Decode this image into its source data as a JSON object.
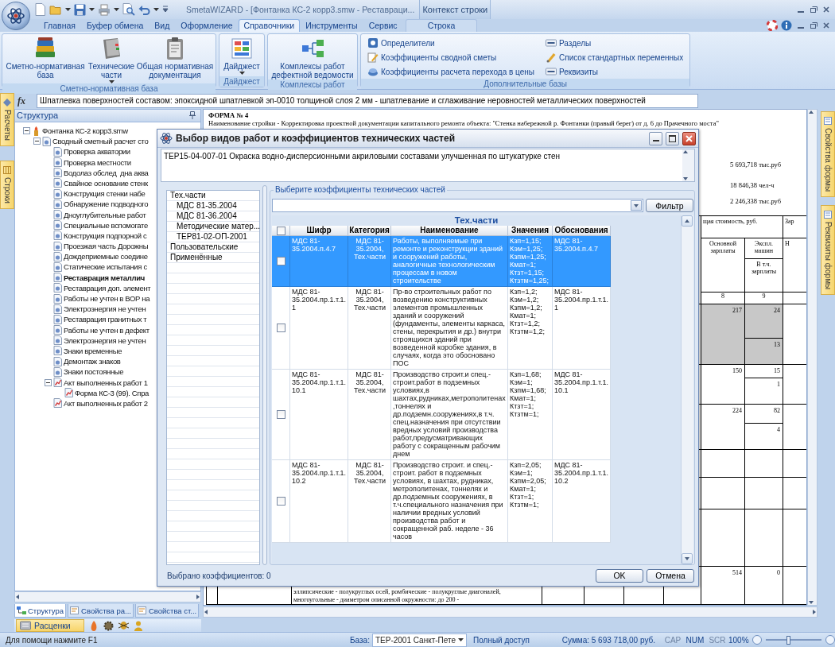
{
  "app": {
    "title": "SmetaWIZARD - [Фонтанка КС-2 корр3.smw - Реставраци...",
    "context_group": "Контекст строки"
  },
  "ribbon_tabs": [
    {
      "label": "Главная",
      "kind": "normal",
      "selected": false
    },
    {
      "label": "Буфер обмена",
      "kind": "normal",
      "selected": false
    },
    {
      "label": "Вид",
      "kind": "normal",
      "selected": false
    },
    {
      "label": "Оформление",
      "kind": "normal",
      "selected": false
    },
    {
      "label": "Справочники",
      "kind": "normal",
      "selected": true
    },
    {
      "label": "Инструменты",
      "kind": "normal",
      "selected": false
    },
    {
      "label": "Сервис",
      "kind": "normal",
      "selected": false
    },
    {
      "label": "Строка",
      "kind": "context",
      "selected": false
    }
  ],
  "ribbon_groups": [
    {
      "title": "Сметно-нормативная база",
      "items": [
        {
          "kind": "large",
          "label": "Сметно-нормативная база",
          "dropdown": false
        },
        {
          "kind": "large",
          "label": "Технические части",
          "dropdown": true
        },
        {
          "kind": "large",
          "label": "Общая нормативная документация",
          "dropdown": false
        }
      ]
    },
    {
      "title": "Дайджест",
      "items": [
        {
          "kind": "large",
          "label": "Дайджест",
          "dropdown": true
        }
      ]
    },
    {
      "title": "Комплексы работ",
      "items": [
        {
          "kind": "large",
          "label": "Комплексы работ дефектной ведомости",
          "dropdown": false
        }
      ]
    },
    {
      "title": "Дополнительные базы",
      "items": [
        {
          "kind": "small",
          "label": "Определители"
        },
        {
          "kind": "small",
          "label": "Коэффициенты сводной сметы"
        },
        {
          "kind": "small",
          "label": "Коэффициенты расчета перехода в цены"
        },
        {
          "kind": "small",
          "label": "Разделы"
        },
        {
          "kind": "small",
          "label": "Список стандартных переменных"
        },
        {
          "kind": "small",
          "label": "Реквизиты"
        }
      ]
    }
  ],
  "formula_bar": {
    "icon": "fx",
    "text": "Шпатлевка поверхностей составом: эпоксидной шпатлевкой эп-0010 толщиной слоя 2 мм - шпатлевание и сглаживание неровностей металлических поверхностей"
  },
  "left_tabs": [
    {
      "label": "Расчеты"
    },
    {
      "label": "Строки"
    }
  ],
  "right_tabs": [
    {
      "label": "Свойства формы"
    },
    {
      "label": "Реквизиты формы"
    }
  ],
  "structure_panel": {
    "title": "Структура",
    "tree": [
      {
        "label": "Фонтанка КС-2 корр3.smw",
        "kind": "file",
        "expanded": true,
        "active": false,
        "children": [
          {
            "label": "Сводный сметный расчет сто",
            "kind": "estimate",
            "expanded": true,
            "active": false,
            "children": [
              {
                "label": "Проверка акватории",
                "kind": "item",
                "active": false
              },
              {
                "label": "Проверка местности",
                "kind": "item",
                "active": false
              },
              {
                "label": "Водолаз обслед  дна аква",
                "kind": "item",
                "active": false
              },
              {
                "label": "Свайное основание стенк",
                "kind": "item",
                "active": false
              },
              {
                "label": "Конструкция стенки набе",
                "kind": "item",
                "active": false
              },
              {
                "label": "Обнаружение подводного",
                "kind": "item",
                "active": false
              },
              {
                "label": "Дноуглубительные работ",
                "kind": "item",
                "active": false
              },
              {
                "label": "Специальные вспомогате",
                "kind": "item",
                "active": false
              },
              {
                "label": "Конструкция подпорной с",
                "kind": "item",
                "active": false
              },
              {
                "label": "Проезжая часть Дорожны",
                "kind": "item",
                "active": false
              },
              {
                "label": "Дождеприемные соедине",
                "kind": "item",
                "active": false
              },
              {
                "label": "Статические испытания с",
                "kind": "item",
                "active": false
              },
              {
                "label": "Реставрация металлич",
                "kind": "item",
                "active": true
              },
              {
                "label": "Реставрация доп. элемент",
                "kind": "item",
                "active": false
              },
              {
                "label": "Работы не учтен в ВОР на",
                "kind": "item",
                "active": false
              },
              {
                "label": "Электроэнергия не учтен",
                "kind": "item",
                "active": false
              },
              {
                "label": "Реставрация гранитных т",
                "kind": "item",
                "active": false
              },
              {
                "label": "Работы не учтен в дефект",
                "kind": "item",
                "active": false
              },
              {
                "label": "Электроэнергия не учтен",
                "kind": "item",
                "active": false
              },
              {
                "label": "Знаки временные",
                "kind": "item",
                "active": false
              },
              {
                "label": "Демонтаж знаков",
                "kind": "item",
                "active": false
              },
              {
                "label": "Знаки постоянные",
                "kind": "item",
                "active": false
              },
              {
                "label": "Акт выполненных работ 1",
                "kind": "act",
                "expanded": true,
                "active": false,
                "children": [
                  {
                    "label": "Форма КС-3 (99). Спра",
                    "kind": "act",
                    "active": false
                  }
                ]
              },
              {
                "label": "Акт выполненных работ 2",
                "kind": "act",
                "active": false
              }
            ]
          }
        ]
      }
    ]
  },
  "panel_tabs": [
    {
      "label": "Структура",
      "selected": true
    },
    {
      "label": "Свойства ра...",
      "selected": false
    },
    {
      "label": "Свойства ст...",
      "selected": false
    }
  ],
  "rates_bar": {
    "label": "Расценки"
  },
  "document": {
    "form_title": "ФОРМА № 4",
    "heading": "Наименование стройки - Корректировка проектной документации капитального ремонта объекта: \"Стенка набережной р. Фонтанки (правый берег) от д. 6 до Прачечного моста\"",
    "totals": [
      "5 693,718 тыс.руб",
      "18 846,38 чел-ч",
      "2 246,338 тыс.руб"
    ],
    "table": {
      "cost_header": "щая стоимость, руб.",
      "cut_header": "Зар",
      "basic_wages": "Основной зарплаты",
      "machines": "Экспл. машин",
      "machine_wages": "В т.ч. зарплаты",
      "cut_subheader": "Н",
      "column_numbers": [
        "8",
        "9"
      ],
      "rows": [
        {
          "shaded": true,
          "basic_wages": "217",
          "machines": "24",
          "machine_wages": "13"
        },
        {
          "shaded": false,
          "basic_wages": "150",
          "machines": "15",
          "machine_wages": "1"
        },
        {
          "shaded": false,
          "basic_wages": "224",
          "machines": "82",
          "machine_wages": "4"
        },
        {
          "shaded": false
        },
        {
          "shaded": false
        },
        {
          "shaded": false
        },
        {
          "shaded": false,
          "text": "эллипсические - полукруглых осей, ромбические - полукруглые диагоналей, многоугольные - диаметром описанной окружности: до 200 -",
          "basic_wages": "514",
          "machines": "0"
        }
      ]
    }
  },
  "dialog": {
    "title": "Выбор видов работ и коэффициентов технических частей",
    "description": "ТЕР15-04-007-01 Окраска водно-дисперсионными акриловыми составами улучшенная по штукатурке стен",
    "categories": [
      {
        "label": "Тех.части",
        "children": [
          {
            "label": "МДС 81-35.2004"
          },
          {
            "label": "МДС 81-36.2004"
          },
          {
            "label": "Методические матер..."
          },
          {
            "label": "ТЕР81-02-ОП-2001"
          }
        ]
      },
      {
        "label": "Пользовательские"
      },
      {
        "label": "Применённые"
      }
    ],
    "group_title": "Выберите коэффициенты технических частей",
    "filter_button": "Фильтр",
    "table": {
      "title": "Тех.части",
      "all_checked": false,
      "columns": [
        "Шифр",
        "Категория",
        "Наименование",
        "Значения",
        "Обоснования"
      ],
      "rows": [
        {
          "selected": true,
          "checked": false,
          "cells": [
            "МДС 81-35.2004.п.4.7",
            "МДС 81-35.2004, Тех.части",
            "Работы, выполняемые при ремонте и реконструкции зданий и сооружений работы, аналогичные технологическим процессам в новом строительстве",
            "Кзп=1,15; Кэм=1,25; Кзпм=1,25; Кмат=1; Ктзт=1,15; Ктзтм=1,25;",
            "МДС 81-35.2004.п.4.7"
          ]
        },
        {
          "selected": false,
          "checked": false,
          "cells": [
            "МДС 81-35.2004.пр.1.т.1.1",
            "МДС 81-35.2004, Тех.части",
            "Пр-во строительных работ по возведению конструктивных элементов промышленных зданий и сооружений (фундаменты, элементы каркаса, стены, перекрытия и др.) внутри строящихся зданий при возведенной коробке здания, в случаях, когда это обосновано ПОС",
            "Кзп=1,2; Кэм=1,2; Кзпм=1,2; Кмат=1; Ктзт=1,2; Ктзтм=1,2;",
            "МДС 81-35.2004.пр.1.т.1.1"
          ]
        },
        {
          "selected": false,
          "checked": false,
          "cells": [
            "МДС 81-35.2004.пр.1.т.1.10.1",
            "МДС 81-35.2004, Тех.части",
            "Производство строит.и спец.-строит.работ в подземных условиях,в шахтах,рудниках,метрополитенах,тоннелях и др.подземн.сооружениях,в т.ч. спец.назначения при отсутствии вредных условий производства работ,предусматривающих работу с сокращенным рабочим днем",
            "Кзп=1,68; Кэм=1; Кзпм=1,68; Кмат=1; Ктзт=1; Ктзтм=1;",
            "МДС 81-35.2004.пр.1.т.1.10.1"
          ]
        },
        {
          "selected": false,
          "checked": false,
          "cells": [
            "МДС 81-35.2004.пр.1.т.1.10.2",
            "МДС 81-35.2004, Тех.части",
            "Производство строит. и спец.-строит. работ в подземных условиях, в шахтах, рудниках, метрополитенах, тоннелях и др.подземных сооружениях, в т.ч.специального назначения при наличии вредных условий производства работ и сокращенной раб. неделе - 36 часов",
            "Кзп=2,05; Кэм=1; Кзпм=2,05; Кмат=1; Ктзт=1; Ктзтм=1;",
            "МДС 81-35.2004.пр.1.т.1.10.2"
          ]
        }
      ]
    },
    "selected_count": "Выбрано коэффициентов: 0",
    "buttons": [
      "OK",
      "Отмена"
    ]
  },
  "status_bar": {
    "help": "Для помощи нажмите F1",
    "base_label": "База:",
    "base_value": "ТЕР-2001 Санкт-Пете",
    "access": "Полный доступ",
    "sum": "Сумма: 5 693 718,00 руб.",
    "indicators": [
      {
        "label": "CAP",
        "on": false
      },
      {
        "label": "NUM",
        "on": true
      },
      {
        "label": "SCR",
        "on": false
      }
    ],
    "zoom": "100%",
    "zoom_slider": {
      "level": 0.4
    }
  }
}
